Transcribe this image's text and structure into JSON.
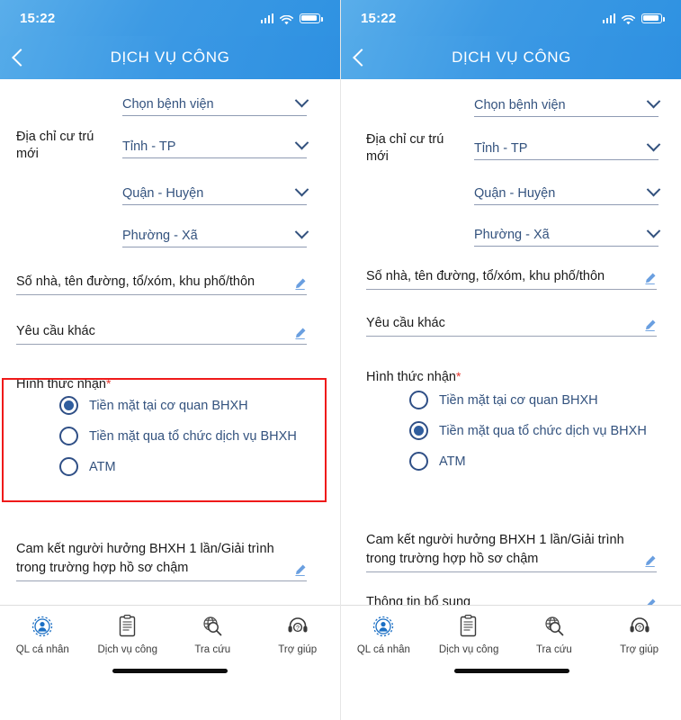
{
  "app": {
    "status_bar": {
      "time": "15:22",
      "signal_icon": "signal-bars-icon",
      "wifi_icon": "wifi-icon",
      "battery_icon": "battery-icon"
    },
    "header": {
      "title": "DỊCH VỤ CÔNG",
      "back_icon": "chevron-left-icon"
    },
    "colors": {
      "header_blue_light": "#55abe9",
      "header_blue_dark": "#2e90e1",
      "field_text_blue": "#33527e",
      "radio_blue": "#2f5d9e",
      "required_red": "#e8332a",
      "highlight_red": "#ef1a1a"
    }
  },
  "form": {
    "address_label": "Địa chỉ cư trú\nmới",
    "address_label_line1": "Địa chỉ cư trú",
    "address_label_line2": "mới",
    "selects": [
      {
        "value": "Chọn bệnh viện",
        "chevron": "chevron-down-icon"
      },
      {
        "value": "Tỉnh - TP",
        "chevron": "chevron-down-icon"
      },
      {
        "value": "Quận - Huyện",
        "chevron": "chevron-down-icon"
      },
      {
        "value": "Phường - Xã",
        "chevron": "chevron-down-icon"
      }
    ],
    "text_fields": [
      {
        "label": "Số nhà, tên đường, tổ/xóm, khu phố/thôn",
        "icon": "pencil-icon"
      },
      {
        "label": "Yêu cầu khác",
        "icon": "pencil-icon"
      }
    ],
    "radio_group": {
      "title": "Hình thức nhận",
      "required_mark": "*",
      "options": [
        "Tiền mặt tại cơ quan BHXH",
        "Tiền mặt qua tổ chức dịch vụ BHXH",
        "ATM"
      ],
      "selected_left": 0,
      "selected_right": 1
    },
    "commit_field": {
      "line1": "Cam kết người hưởng BHXH 1 lần/Giải trình",
      "line2": "trong trường hợp hồ sơ chậm",
      "icon": "pencil-icon"
    },
    "extra_field": {
      "label": "Thông tin bổ sung",
      "icon": "pencil-icon"
    }
  },
  "bottom_nav": {
    "items": [
      {
        "label": "QL cá nhân",
        "icon": "personal-management-icon"
      },
      {
        "label": "Dịch vụ công",
        "icon": "document-icon"
      },
      {
        "label": "Tra cứu",
        "icon": "search-globe-icon"
      },
      {
        "label": "Trợ giúp",
        "icon": "headset-help-icon"
      }
    ]
  }
}
